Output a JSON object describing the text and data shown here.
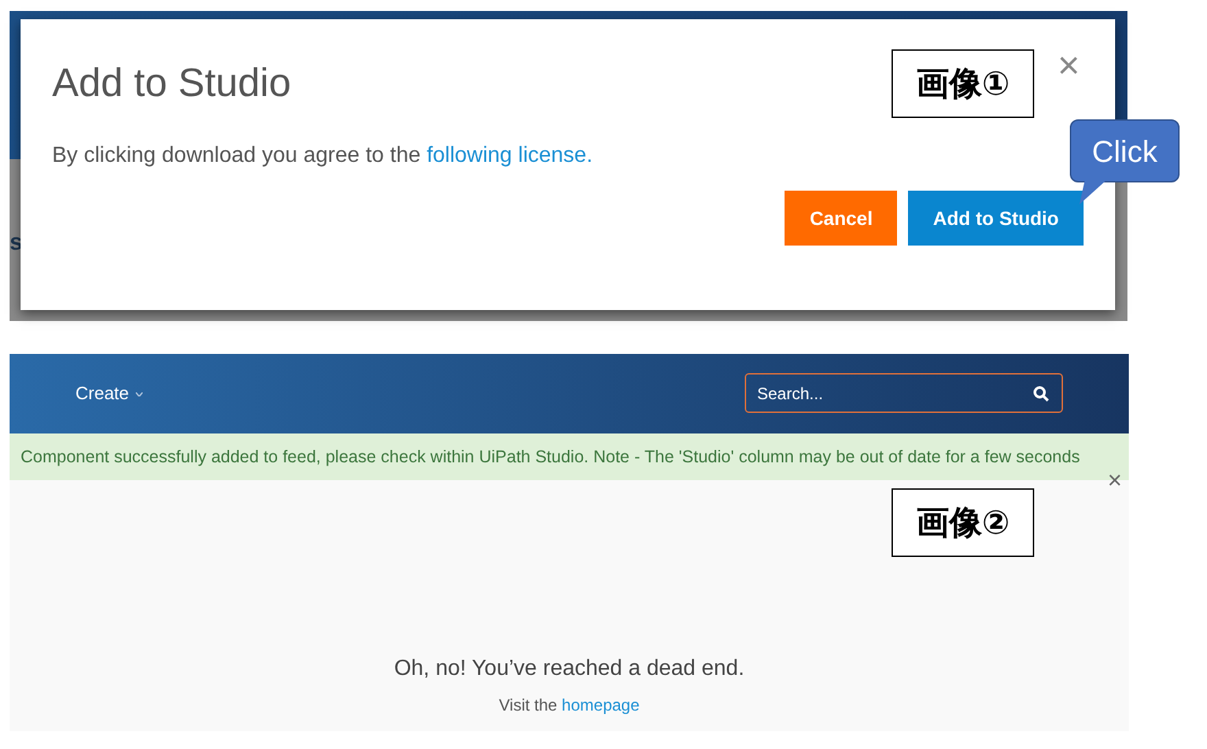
{
  "screenshot_1": {
    "background_fragment": "s",
    "dialog": {
      "title": "Add to Studio",
      "close": "×",
      "message": "By clicking download you agree to the",
      "link": "following license.",
      "buttons": [
        {
          "label": "Cancel",
          "kind": "cancel"
        },
        {
          "label": "Add to Studio",
          "kind": "primary"
        }
      ]
    },
    "annotation": "画像①",
    "callout": "Click"
  },
  "screenshot_2": {
    "navbar": {
      "menu": "Create",
      "search": {
        "placeholder": "Search..."
      }
    },
    "alert": {
      "message": "Component successfully added to feed, please check within UiPath Studio. Note - The 'Studio' column may be out of date for a few seconds",
      "close": "×"
    },
    "error_page": {
      "heading": "Oh, no! You’ve reached a dead end.",
      "prefix": "Visit the",
      "link": "homepage"
    },
    "annotation": "画像②"
  }
}
